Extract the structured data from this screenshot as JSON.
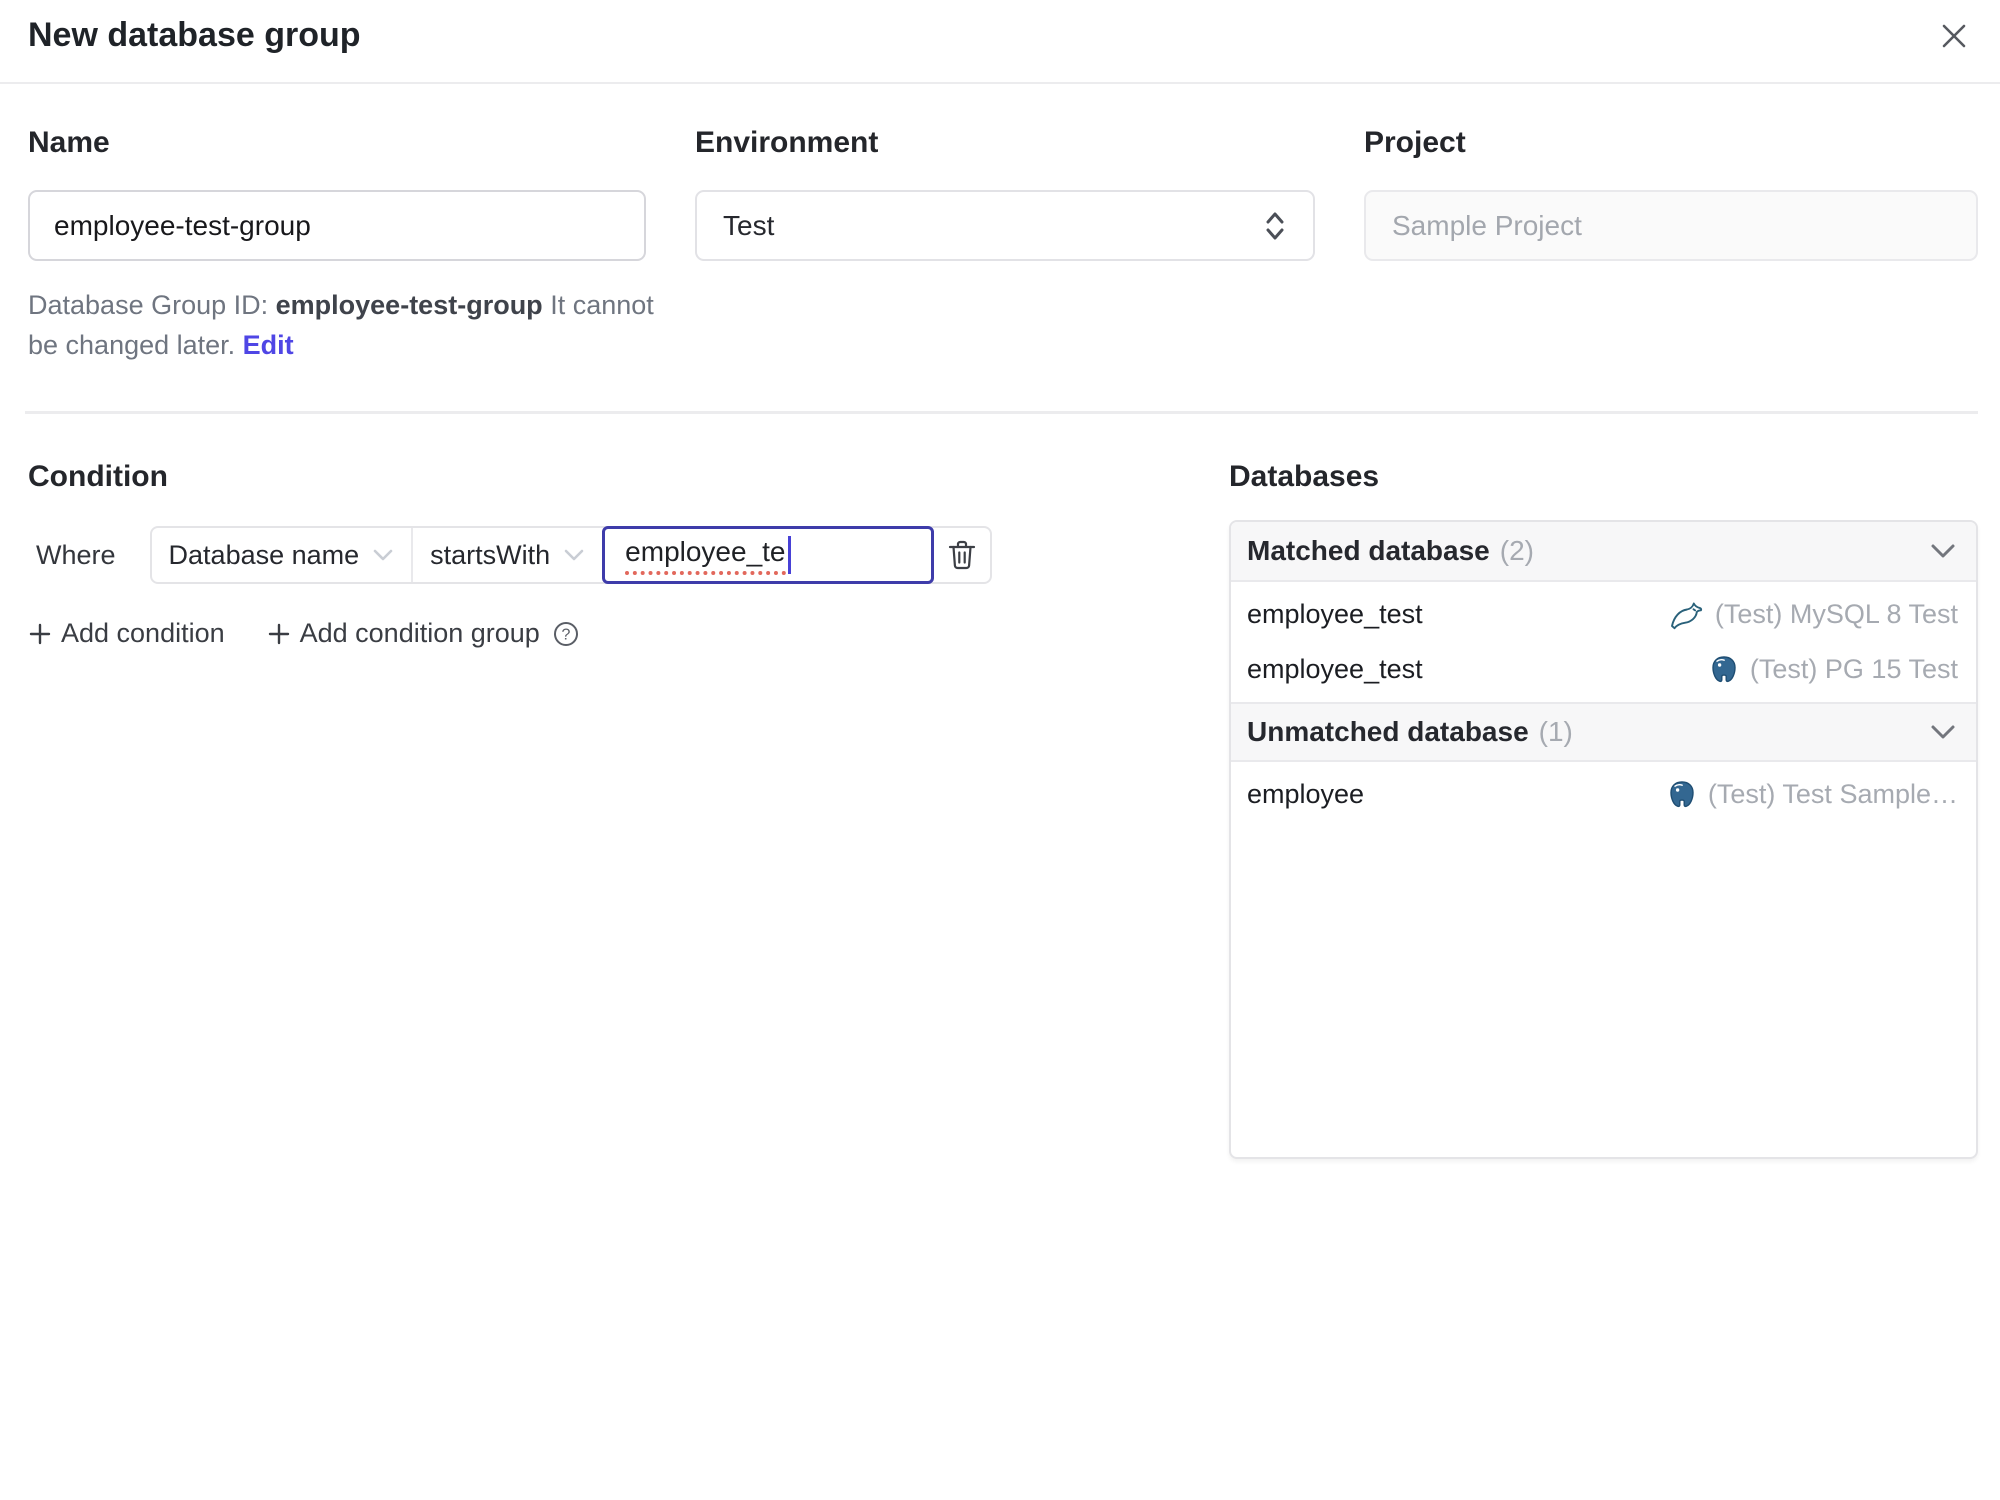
{
  "dialog": {
    "title": "New database group"
  },
  "form": {
    "name": {
      "label": "Name",
      "value": "employee-test-group"
    },
    "environment": {
      "label": "Environment",
      "value": "Test"
    },
    "project": {
      "label": "Project",
      "value": "Sample Project"
    },
    "group_id_hint": {
      "prefix": "Database Group ID: ",
      "id": "employee-test-group",
      "suffix": " It cannot be changed later. ",
      "edit_label": "Edit"
    }
  },
  "condition": {
    "heading": "Condition",
    "where_label": "Where",
    "factor": "Database name",
    "operator": "startsWith",
    "value": "employee_te",
    "add_condition_label": "Add condition",
    "add_condition_group_label": "Add condition group"
  },
  "databases": {
    "heading": "Databases",
    "matched": {
      "title": "Matched database",
      "count": "(2)",
      "rows": [
        {
          "name": "employee_test",
          "instance": "(Test) MySQL 8 Test",
          "engine": "mysql"
        },
        {
          "name": "employee_test",
          "instance": "(Test) PG 15 Test",
          "engine": "postgresql"
        }
      ]
    },
    "unmatched": {
      "title": "Unmatched database",
      "count": "(1)",
      "rows": [
        {
          "name": "employee",
          "instance": "(Test) Test Sample…",
          "engine": "postgresql"
        }
      ]
    }
  },
  "colors": {
    "accent": "#4f46e5",
    "focused_border": "#3e3caa",
    "spellcheck_underline": "#e2685c",
    "mysql_icon": "#29617a",
    "postgresql_icon": "#336791"
  }
}
